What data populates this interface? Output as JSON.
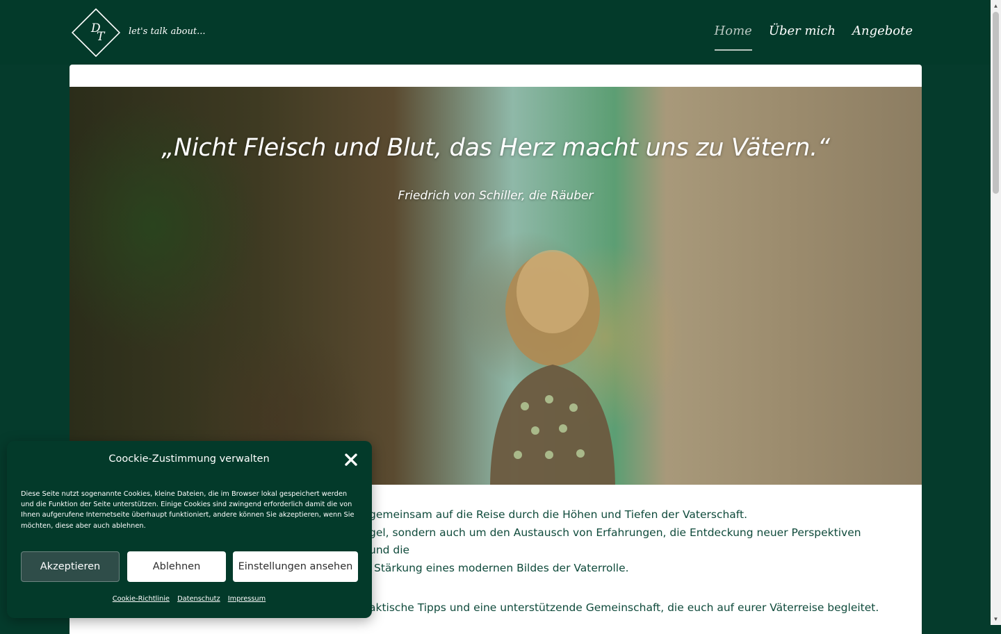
{
  "header": {
    "logo_monogram": "DT",
    "tagline": "let's talk about...",
    "nav": [
      {
        "label": "Home",
        "active": true
      },
      {
        "label": "Über mich",
        "active": false
      },
      {
        "label": "Angebote",
        "active": false
      }
    ]
  },
  "hero": {
    "quote": "„Nicht Fleisch und Blut, das Herz macht uns zu Vätern.“",
    "author": "Friedrich von Schiller, die Räuber"
  },
  "main": {
    "paragraph_1_line_1": "gemeinsam auf die Reise durch die Höhen und Tiefen der Vaterschaft.",
    "paragraph_1_line_2": "gel, sondern auch um den Austausch von Erfahrungen, die Entdeckung neuer Perspektiven und die",
    "paragraph_1_line_3": "Stärkung eines modernen Bildes der Vaterrolle.",
    "paragraph_2": "aktische Tipps und eine unterstützende Gemeinschaft, die euch auf eurer Väterreise begleitet."
  },
  "cookie": {
    "title": "Coockie-Zustimmung verwalten",
    "text": "Diese Seite nutzt sogenannte Cookies, kleine Dateien, die im Browser lokal gespeichert werden und die Funktion der Seite unterstützen. Einige Cookies sind zwingend erforderlich damit die von Ihnen aufgerufene Internetseite überhaupt funktioniert, andere können Sie akzeptieren, wenn Sie möchten, diese aber auch ablehnen.",
    "accept": "Akzeptieren",
    "deny": "Ablehnen",
    "settings": "Einstellungen ansehen",
    "links": [
      "Cookie-Richtlinie",
      "Datenschutz",
      "Impressum"
    ]
  },
  "colors": {
    "background": "#053b2c",
    "header": "#033a2a",
    "text_green": "#0f4a3b",
    "accept_button": "#2f4d49"
  }
}
